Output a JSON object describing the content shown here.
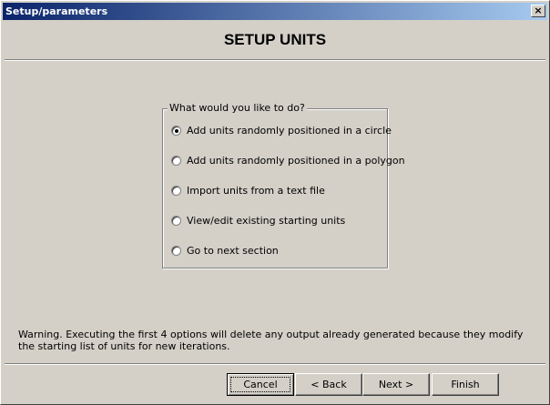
{
  "window": {
    "title": "Setup/parameters",
    "close_glyph": "×"
  },
  "header": {
    "title": "SETUP UNITS"
  },
  "group": {
    "legend": "What would you like to do?",
    "options": [
      {
        "label": "Add units randomly positioned in a circle",
        "checked": true
      },
      {
        "label": "Add units randomly positioned in a polygon",
        "checked": false
      },
      {
        "label": "Import units from a text file",
        "checked": false
      },
      {
        "label": "View/edit existing starting units",
        "checked": false
      },
      {
        "label": "Go to next section",
        "checked": false
      }
    ]
  },
  "warning": {
    "text": "Warning.  Executing the first 4 options will delete any output already generated because they modify the starting list of units for new iterations."
  },
  "buttons": {
    "cancel": "Cancel",
    "back": "< Back",
    "next": "Next >",
    "finish": "Finish"
  }
}
